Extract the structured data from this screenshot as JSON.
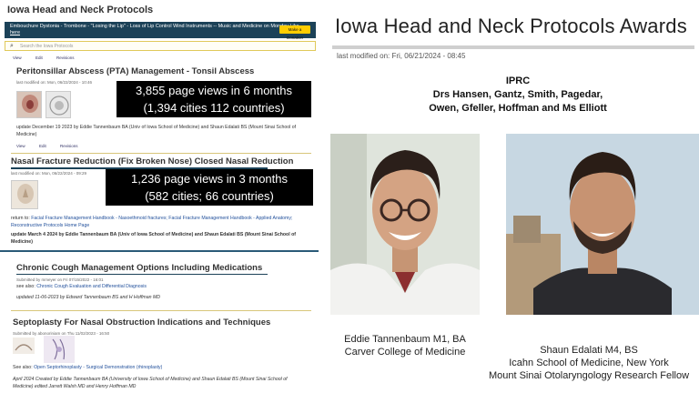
{
  "collage": {
    "site_title": "Iowa Head and Neck Protocols",
    "banner_text": "Embouchure Dystonia - Trombone - \"Losing the Lip\" - Loss of Lip Control Wind Instruments -- Music and Medicine on Monday",
    "banner_link": "Like here",
    "banner_button": "Make a Donation",
    "search_placeholder": "Search the Iowa Protocols",
    "sections": [
      {
        "title": "Peritonsillar Abscess (PTA) Management - Tonsil Abscess",
        "modified": "last modified on: Mon, 06/22/2024 - 10:46",
        "views_line1": "3,855 page views in 6 months",
        "views_line2": "(1,394 cities 112 countries)",
        "update": "update December 19 2023 by Eddie Tannenbaum BA  (Univ of Iowa School of Medicine) and Shaun Edalati BS (Mount Sinai School of Medicine)",
        "tabs": [
          "View",
          "Edit",
          "Revisions"
        ]
      },
      {
        "title": "Nasal Fracture Reduction (Fix Broken Nose) Closed Nasal Reduction",
        "modified": "last modified on: Mon, 06/22/2024 - 09:29",
        "views_line1": "1,236 page views in 3 months",
        "views_line2": "(582 cities; 66 countries)",
        "return_label": "return to:",
        "return_links": "Facial Fracture Management Handbook - Nasoethmoid fractures; Facial Fracture Management Handbook - Applied Anatomy; Reconstructive Protocols Home Page",
        "update": "update March 4 2024 by Eddie Tannenbaum BA  (Univ of Iowa School of Medicine) and Shaun Edalati BS (Mount Sinai School of Medicine)"
      },
      {
        "title": "Chronic Cough Management Options Including Medications",
        "submitted": "Submitted by mmeyer on Fri 07/15/2022 - 16:01",
        "see_also_label": "see also:",
        "see_also_link": "Chronic Cough Evaluation and Differential Diagnosis",
        "update": "updated 11-06-2023 by Edward Tannenbaum BS and H Hoffman MD"
      },
      {
        "title": "Septoplasty For Nasal Obstruction Indications and Techniques",
        "submitted": "Submitted by abonoriniam on Thu 11/02/2023 - 16:50",
        "see_also_label": "See also:",
        "see_also_link": "Open Septorhinoplasty - Surgical Demonstration (rhinoplasty)",
        "update": "April 2024 Created by Eddie Tannenbaum BA (University of Iowa School of Medicine) and Shaun Edalati BS (Mount Sinai School of Medicine) edited Jarrett Walsh MD and Henry  Hoffman MD"
      }
    ]
  },
  "awards": {
    "title": "Iowa Head and Neck Protocols Awards",
    "modified": "last modified on: Fri, 06/21/2024 - 08:45",
    "iprc_line1": "IPRC",
    "iprc_line2": "Drs Hansen,  Gantz,  Smith,  Pagedar,",
    "iprc_line3": "Owen,  Gfeller,  Hoffman and Ms Elliott",
    "person1_line1": "Eddie Tannenbaum M1, BA",
    "person1_line2": "Carver College of Medicine",
    "person2_line1": "Shaun Edalati M4, BS",
    "person2_line2": "Icahn School of Medicine, New York",
    "person2_line3": "Mount Sinai Otolaryngology Research Fellow"
  },
  "colors": {
    "banner": "#1c4258",
    "donate": "#ffcd00",
    "views_box": "#000000"
  }
}
